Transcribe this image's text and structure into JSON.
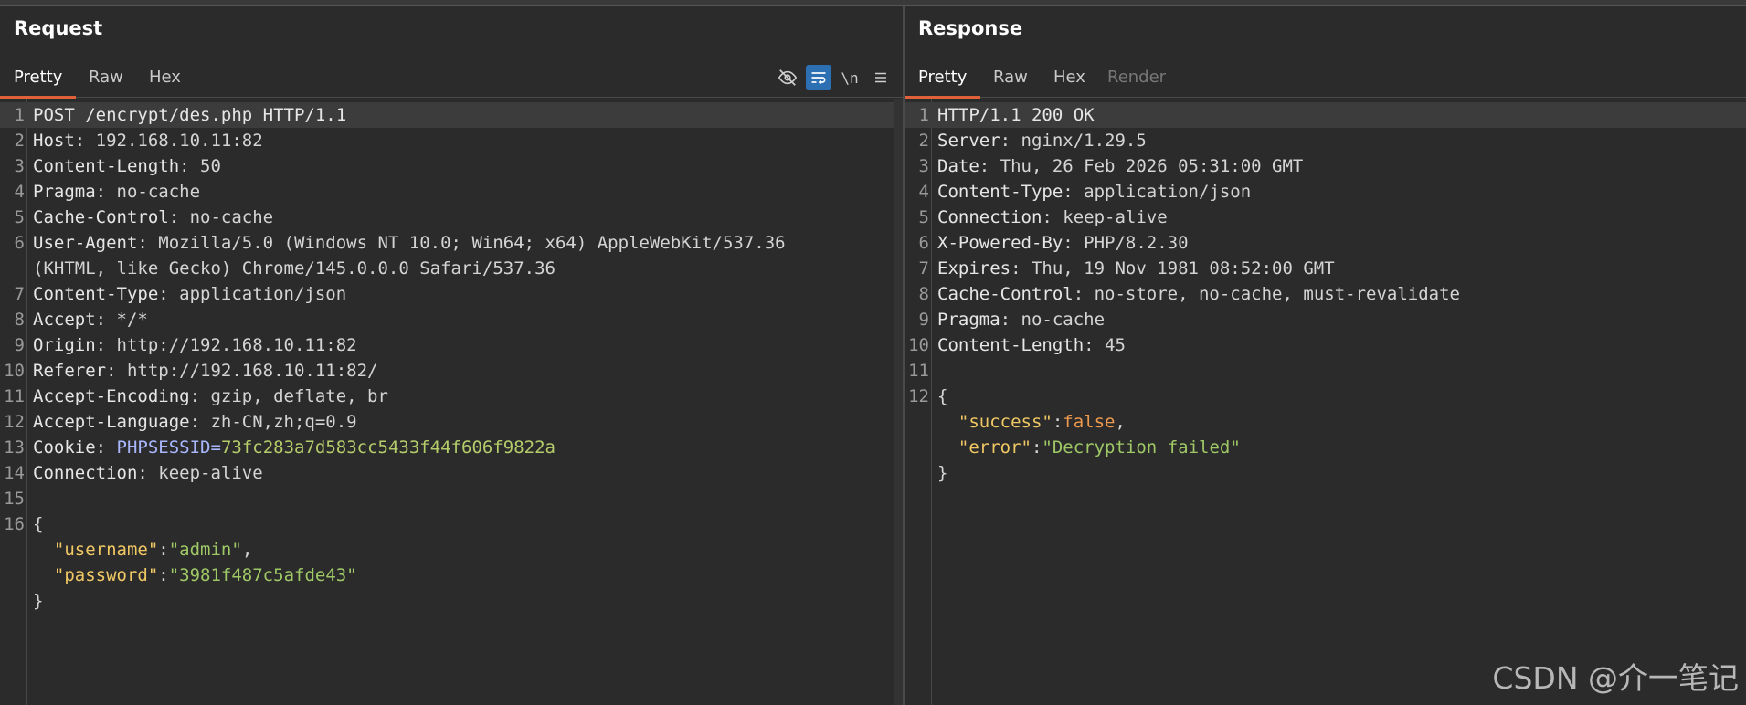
{
  "request": {
    "title": "Request",
    "tabs": [
      {
        "label": "Pretty",
        "active": true
      },
      {
        "label": "Raw",
        "active": false
      },
      {
        "label": "Hex",
        "active": false
      }
    ],
    "tools": [
      {
        "icon": "eye-slash-icon"
      },
      {
        "icon": "wrap-lines-icon",
        "active": true
      },
      {
        "icon": "newline-icon",
        "label": "\\n"
      },
      {
        "icon": "menu-icon"
      }
    ],
    "lines": [
      {
        "n": "1",
        "key": "POST /encrypt/des.php HTTP/1.1",
        "val": ""
      },
      {
        "n": "2",
        "key": "Host",
        "val": ": 192.168.10.11:82"
      },
      {
        "n": "3",
        "key": "Content-Length",
        "val": ": 50"
      },
      {
        "n": "4",
        "key": "Pragma",
        "val": ": no-cache"
      },
      {
        "n": "5",
        "key": "Cache-Control",
        "val": ": no-cache"
      },
      {
        "n": "6",
        "key": "User-Agent",
        "val": ": Mozilla/5.0 (Windows NT 10.0; Win64; x64) AppleWebKit/537.36"
      },
      {
        "n": "",
        "key": "",
        "val": "(KHTML, like Gecko) Chrome/145.0.0.0 Safari/537.36"
      },
      {
        "n": "7",
        "key": "Content-Type",
        "val": ": application/json"
      },
      {
        "n": "8",
        "key": "Accept",
        "val": ": */*"
      },
      {
        "n": "9",
        "key": "Origin",
        "val": ": http://192.168.10.11:82"
      },
      {
        "n": "10",
        "key": "Referer",
        "val": ": http://192.168.10.11:82/"
      },
      {
        "n": "11",
        "key": "Accept-Encoding",
        "val": ": gzip, deflate, br"
      },
      {
        "n": "12",
        "key": "Accept-Language",
        "val": ": zh-CN,zh;q=0.9"
      },
      {
        "n": "13",
        "key": "Cookie",
        "val": ": ",
        "cookie_name": "PHPSESSID",
        "cookie_eq": "=",
        "cookie_val": "73fc283a7d583cc5433f44f606f9822a"
      },
      {
        "n": "14",
        "key": "Connection",
        "val": ": keep-alive"
      },
      {
        "n": "15",
        "key": "",
        "val": ""
      },
      {
        "n": "16",
        "key": "",
        "val": "{"
      }
    ],
    "json_body": {
      "open": "{",
      "lines": [
        {
          "key": "\"username\"",
          "sep": ":",
          "val": "\"admin\"",
          "tail": ","
        },
        {
          "key": "\"password\"",
          "sep": ":",
          "val": "\"3981f487c5afde43\"",
          "tail": ""
        }
      ],
      "close": "}"
    }
  },
  "response": {
    "title": "Response",
    "tabs": [
      {
        "label": "Pretty",
        "active": true
      },
      {
        "label": "Raw",
        "active": false
      },
      {
        "label": "Hex",
        "active": false
      },
      {
        "label": "Render",
        "active": false,
        "disabled": true
      }
    ],
    "lines": [
      {
        "n": "1",
        "key": "HTTP/1.1 200 OK",
        "val": ""
      },
      {
        "n": "2",
        "key": "Server",
        "val": ": nginx/1.29.5"
      },
      {
        "n": "3",
        "key": "Date",
        "val": ": Thu, 26 Feb 2026 05:31:00 GMT"
      },
      {
        "n": "4",
        "key": "Content-Type",
        "val": ": application/json"
      },
      {
        "n": "5",
        "key": "Connection",
        "val": ": keep-alive"
      },
      {
        "n": "6",
        "key": "X-Powered-By",
        "val": ": PHP/8.2.30"
      },
      {
        "n": "7",
        "key": "Expires",
        "val": ": Thu, 19 Nov 1981 08:52:00 GMT"
      },
      {
        "n": "8",
        "key": "Cache-Control",
        "val": ": no-store, no-cache, must-revalidate"
      },
      {
        "n": "9",
        "key": "Pragma",
        "val": ": no-cache"
      },
      {
        "n": "10",
        "key": "Content-Length",
        "val": ": 45"
      },
      {
        "n": "11",
        "key": "",
        "val": ""
      },
      {
        "n": "12",
        "key": "",
        "val": "{"
      }
    ],
    "json_body": {
      "lines": [
        {
          "key": "\"success\"",
          "sep": ":",
          "val": "false",
          "tail": ",",
          "type": "bool"
        },
        {
          "key": "\"error\"",
          "sep": ":",
          "val": "\"Decryption failed\"",
          "tail": "",
          "type": "str"
        }
      ],
      "close": "}"
    }
  },
  "watermark": "CSDN @介一笔记",
  "colors": {
    "background": "#2b2b2b",
    "active_tab_underline": "#e0623a",
    "active_tool": "#2d6fb3",
    "json_key": "#f0c864",
    "json_string": "#9fc966",
    "json_bool": "#ef9a4e",
    "cookie_name": "#a9b7ff",
    "cookie_value": "#b5cc6b"
  }
}
